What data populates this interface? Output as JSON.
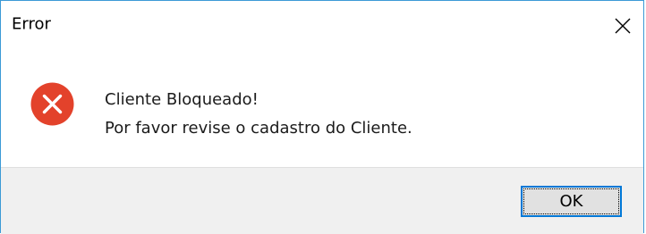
{
  "dialog": {
    "title": "Error",
    "close_icon": "close-icon",
    "icon": "error-icon",
    "message_lines": [
      "Cliente Bloqueado!",
      "Por favor revise o cadastro do Cliente."
    ],
    "ok_label": "OK"
  },
  "colors": {
    "border": "#3c9ad6",
    "error_red": "#e3422b",
    "footer_bg": "#f0f0f0",
    "button_border": "#0078d7"
  }
}
